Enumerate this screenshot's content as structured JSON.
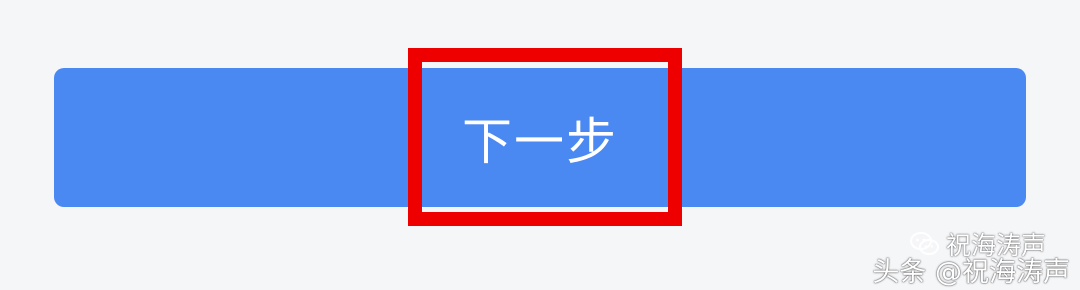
{
  "button": {
    "label": "下一步"
  },
  "watermark": {
    "wechat_account": "祝海涛声",
    "toutiao_account": "头条 @祝海涛声"
  },
  "colors": {
    "background": "#f5f6f8",
    "button": "#4a88f2",
    "button_text": "#ffffff",
    "highlight": "#ee0000"
  },
  "icons": {
    "watermark_icon": "wechat-icon"
  }
}
